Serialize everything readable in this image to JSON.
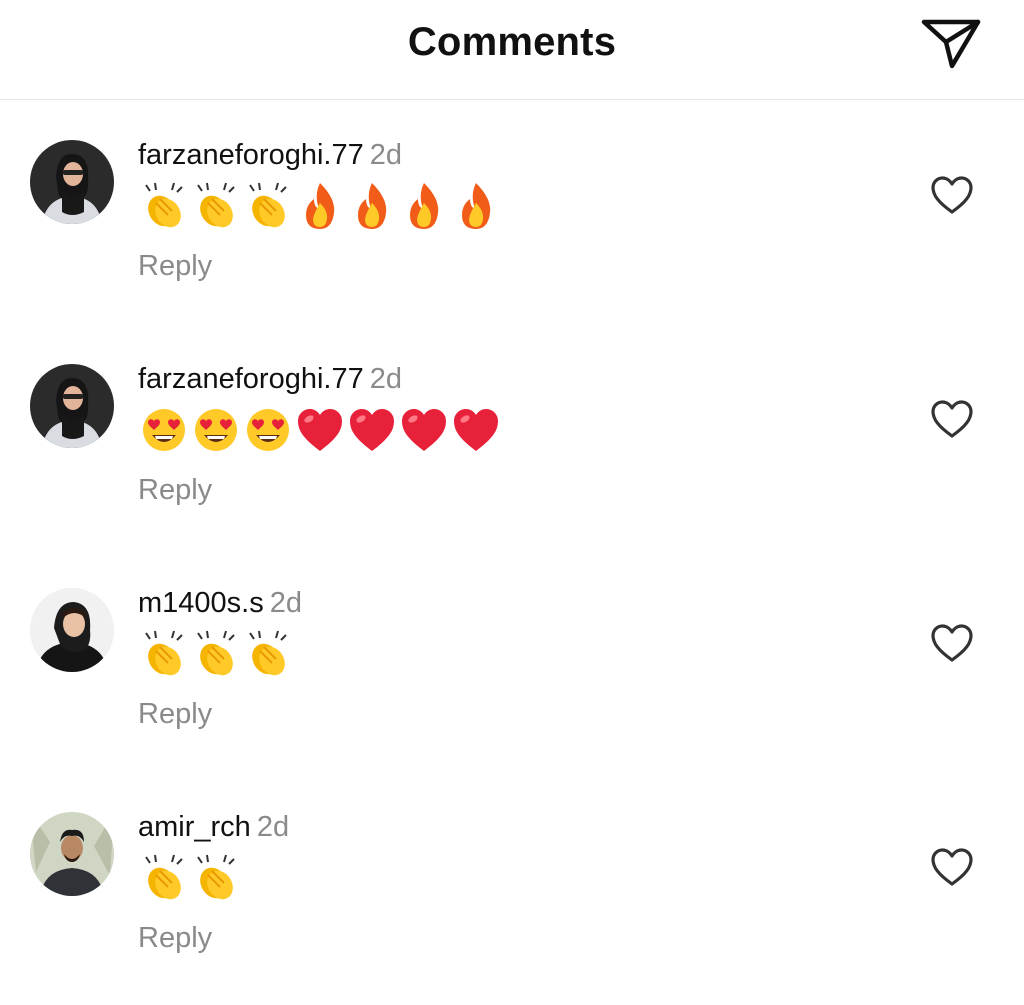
{
  "header": {
    "title": "Comments",
    "share_icon": "paper-plane-icon"
  },
  "comments": [
    {
      "username": "farzaneforoghi.77",
      "time": "2d",
      "emojis": [
        "clapping-hands",
        "clapping-hands",
        "clapping-hands",
        "fire",
        "fire",
        "fire",
        "fire"
      ],
      "reply_label": "Reply",
      "like_icon": "heart-outline-icon",
      "avatar": "profile-photo"
    },
    {
      "username": "farzaneforoghi.77",
      "time": "2d",
      "emojis": [
        "heart-eyes",
        "heart-eyes",
        "heart-eyes",
        "red-heart",
        "red-heart",
        "red-heart",
        "red-heart"
      ],
      "reply_label": "Reply",
      "like_icon": "heart-outline-icon",
      "avatar": "profile-photo"
    },
    {
      "username": "m1400s.s",
      "time": "2d",
      "emojis": [
        "clapping-hands",
        "clapping-hands",
        "clapping-hands"
      ],
      "reply_label": "Reply",
      "like_icon": "heart-outline-icon",
      "avatar": "profile-photo"
    },
    {
      "username": "amir_rch",
      "time": "2d",
      "emojis": [
        "clapping-hands",
        "clapping-hands"
      ],
      "reply_label": "Reply",
      "like_icon": "heart-outline-icon",
      "avatar": "profile-photo"
    }
  ],
  "colors": {
    "text": "#111111",
    "secondary_text": "#8a8a8a",
    "divider": "#e6e6e6",
    "background": "#ffffff"
  }
}
